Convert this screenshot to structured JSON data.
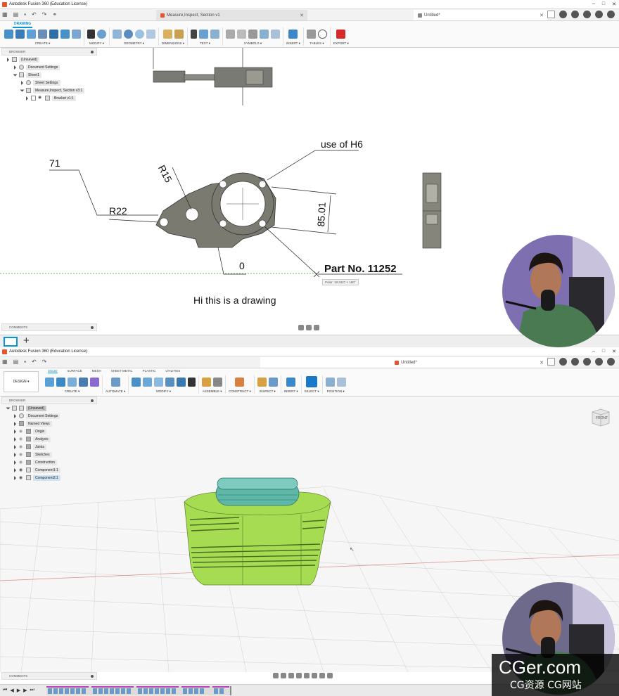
{
  "top": {
    "title": "Autodesk Fusion 360 (Education License)",
    "tabs": [
      {
        "label": "Measure,Inspect, Section v1"
      },
      {
        "label": "Untitled*"
      }
    ],
    "mode": "DRAWING",
    "ribbon_groups": [
      "CREATE ▾",
      "MODIFY ▾",
      "GEOMETRY ▾",
      "DIMENSIONS ▾",
      "TEXT ▾",
      "SYMBOLS ▾",
      "INSERT ▾",
      "TABLES ▾",
      "EXPORT ▾"
    ],
    "browser": {
      "header": "BROWSER",
      "items": [
        "(Unsaved)",
        "Document Settings",
        "Sheet1",
        "Sheet Settings",
        "Measure,Inspect, Section v3:1",
        "Bracket v1:1"
      ]
    },
    "annotations": {
      "dim_71": "71",
      "dim_r15": "R15",
      "dim_r22": "R22",
      "dim_8501": "85.01",
      "dim_0": "0",
      "note_h6": "use of  H6",
      "part_no": "Part No. 11252",
      "caption": "Hi this is a drawing",
      "cursor_tip": "Polar: 18.3427 < 180°"
    },
    "comments": "COMMENTS"
  },
  "bottom": {
    "title": "Autodesk Fusion 360 (Education License)",
    "tab": "Untitled*",
    "design_button": "DESIGN ▾",
    "workspace_tabs": [
      "SOLID",
      "SURFACE",
      "MESH",
      "SHEET METAL",
      "PLASTIC",
      "UTILITIES"
    ],
    "ribbon_groups": [
      "CREATE ▾",
      "AUTOMATE ▾",
      "MODIFY ▾",
      "ASSEMBLE ▾",
      "CONSTRUCT ▾",
      "INSPECT ▾",
      "INSERT ▾",
      "SELECT ▾",
      "POSITION ▾"
    ],
    "browser": {
      "header": "BROWSER",
      "items": [
        "(Unsaved)",
        "Document Settings",
        "Named Views",
        "Origin",
        "Analysis",
        "Joints",
        "Sketches",
        "Construction",
        "Component1:1",
        "Component2:1"
      ]
    },
    "viewcube_label": "FRONT",
    "comments": "COMMENTS"
  },
  "watermark": {
    "line1": "CGer.com",
    "line2": "CG资源  CG网站"
  },
  "colors": {
    "accent": "#0696d7",
    "brand": "#e8542b",
    "body_green": "#a6dc52",
    "cap_teal": "#5eb8a8"
  }
}
